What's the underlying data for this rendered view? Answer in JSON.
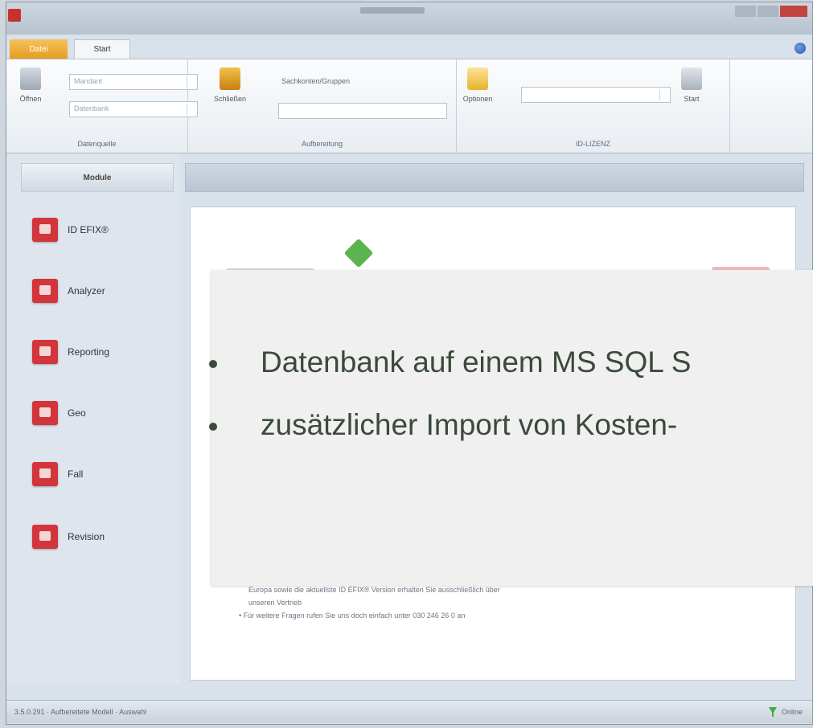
{
  "window": {
    "file_tab": "Datei",
    "start_tab": "Start"
  },
  "ribbon": {
    "group1": {
      "label": "Datenquelle",
      "open_button": "Öffnen",
      "combo1": "Mandant",
      "combo2": "Datenbank"
    },
    "group2": {
      "label": "Aufbereitung",
      "close_button": "Schließen",
      "field_label": "Sachkonten/Gruppen"
    },
    "group3": {
      "label": "ID-LIZENZ",
      "options_button": "Optionen",
      "start_button": "Start"
    }
  },
  "modules": {
    "header": "Module",
    "items": [
      {
        "label": "ID EFIX®"
      },
      {
        "label": "Analyzer"
      },
      {
        "label": "Reporting"
      },
      {
        "label": "Geo"
      },
      {
        "label": "Fall"
      },
      {
        "label": "Revision"
      }
    ]
  },
  "content": {
    "lines": [
      "Europa sowie die aktuellste ID EFIX® Version erhalten Sie ausschließlich über",
      "unseren Vertrieb",
      "Für weitere Fragen rufen Sie uns doch einfach unter 030 246 26 0 an"
    ]
  },
  "status": {
    "left": "3.5.0.291 · Aufbereitete Modell · Auswahl",
    "right": "Online"
  },
  "overlay": {
    "bullets": [
      "Datenbank auf einem MS SQL S",
      " zusätzlicher Import von Kosten-"
    ]
  }
}
